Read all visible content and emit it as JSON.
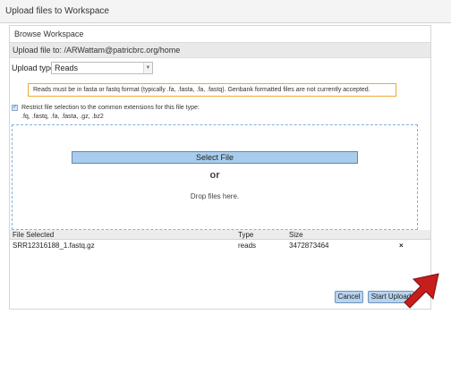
{
  "dialog": {
    "title": "Upload files to Workspace"
  },
  "browse": {
    "heading": "Browse Workspace",
    "path_label": "Upload file to: /ARWattam@patricbrc.org/home"
  },
  "upload_type": {
    "label": "Upload type:",
    "value": "Reads"
  },
  "notice": {
    "text": "Reads must be in fasta or fastq format (typically .fa, .fasta, .fa, .fastq). Genbank formatted files are not currently accepted.",
    "border_color": "#f0a833"
  },
  "restrict": {
    "checked": true,
    "label": "Restrict file selection to the common extensions for this file type:",
    "extensions": ".fq, .fastq, .fa, .fasta, .gz, .bz2"
  },
  "drop_zone": {
    "select_label": "Select File",
    "or_label": "or",
    "drop_label": "Drop files here."
  },
  "table": {
    "headers": [
      "File Selected",
      "Type",
      "Size"
    ],
    "rows": [
      {
        "file": "SRR12316188_1.fastq.gz",
        "type": "reads",
        "size": "3472873464",
        "remove": "×"
      }
    ]
  },
  "buttons": {
    "cancel": "Cancel",
    "start_upload": "Start Upload"
  },
  "colors": {
    "accent": "#b7d3ee",
    "arrow": "#c61d1d"
  }
}
